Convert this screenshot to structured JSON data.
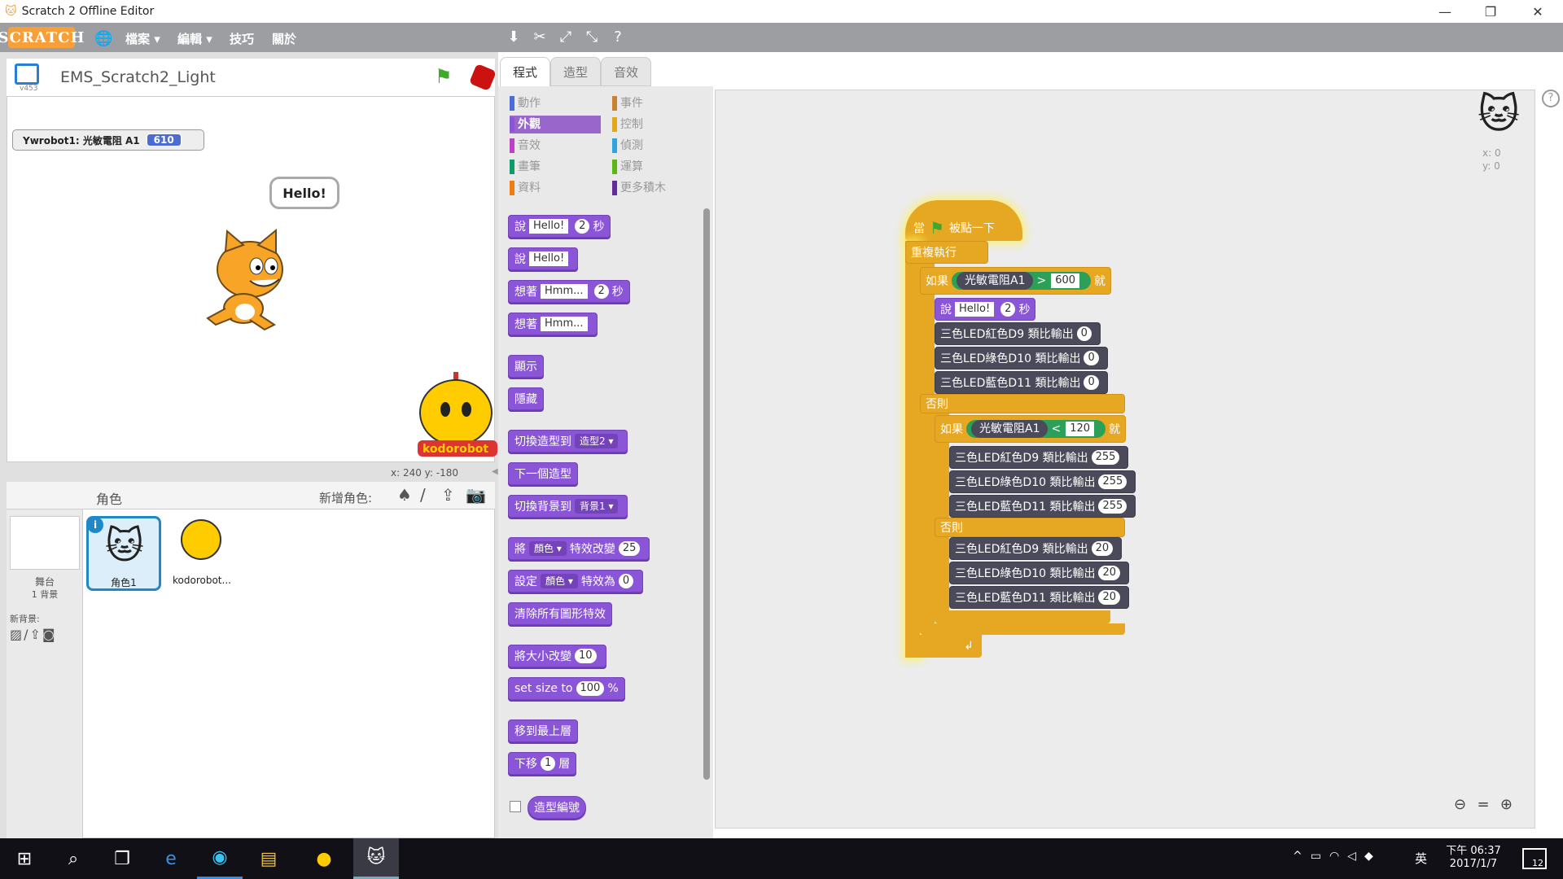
{
  "window": {
    "title": "Scratch 2 Offline Editor",
    "minimize": "—",
    "maximize": "❐",
    "close": "✕"
  },
  "menubar": {
    "logo": "SCRATCH",
    "items": [
      "檔案 ▾",
      "編輯 ▾",
      "技巧",
      "關於"
    ]
  },
  "stage": {
    "project_title": "EMS_Scratch2_Light",
    "version": "v453",
    "monitor_label": "Ywrobot1: 光敏電阻 A1",
    "monitor_value": "610",
    "bubble": "Hello!",
    "coords": "x: 240   y: -180"
  },
  "sprites": {
    "header": "角色",
    "new_sprite": "新增角色:",
    "stage_label": "舞台",
    "stage_sub": "1 背景",
    "new_backdrop": "新背景:",
    "items": [
      "角色1",
      "kodorobot..."
    ],
    "info": "i"
  },
  "tabs": [
    "程式",
    "造型",
    "音效"
  ],
  "categories": [
    {
      "label": "動作",
      "color": "#4a6cd4"
    },
    {
      "label": "事件",
      "color": "#c88330"
    },
    {
      "label": "外觀",
      "color": "#8a55d7"
    },
    {
      "label": "控制",
      "color": "#e1a91a"
    },
    {
      "label": "音效",
      "color": "#bb42c3"
    },
    {
      "label": "偵測",
      "color": "#2ca5e2"
    },
    {
      "label": "畫筆",
      "color": "#0e9a6c"
    },
    {
      "label": "運算",
      "color": "#5cb712"
    },
    {
      "label": "資料",
      "color": "#ee7d16"
    },
    {
      "label": "更多積木",
      "color": "#632d99"
    }
  ],
  "palette": {
    "say_secs": [
      "說",
      "Hello!",
      "2",
      "秒"
    ],
    "say": [
      "說",
      "Hello!"
    ],
    "think_secs": [
      "想著",
      "Hmm...",
      "2",
      "秒"
    ],
    "think": [
      "想著",
      "Hmm..."
    ],
    "show": "顯示",
    "hide": "隱藏",
    "switch_costume": [
      "切換造型到",
      "造型2 ▾"
    ],
    "next_costume": "下一個造型",
    "switch_backdrop": [
      "切換背景到",
      "背景1 ▾"
    ],
    "change_effect": [
      "將",
      "顏色 ▾",
      "特效改變",
      "25"
    ],
    "set_effect": [
      "設定",
      "顏色 ▾",
      "特效為",
      "0"
    ],
    "clear_effects": "清除所有圖形特效",
    "change_size": [
      "將大小改變",
      "10"
    ],
    "set_size": [
      "set size to",
      "100",
      "%"
    ],
    "front": "移到最上層",
    "back": [
      "下移",
      "1",
      "層"
    ],
    "costume_num": "造型編號"
  },
  "script": {
    "hat": [
      "當",
      "被點一下"
    ],
    "forever": "重複執行",
    "if1": [
      "如果",
      "光敏電阻A1",
      ">",
      "600",
      "就"
    ],
    "say": [
      "說",
      "Hello!",
      "2",
      "秒"
    ],
    "rgb_a": [
      [
        "三色LED紅色D9 類比輸出",
        "0"
      ],
      [
        "三色LED綠色D10 類比輸出",
        "0"
      ],
      [
        "三色LED藍色D11 類比輸出",
        "0"
      ]
    ],
    "else1": "否則",
    "if2": [
      "如果",
      "光敏電阻A1",
      "<",
      "120",
      "就"
    ],
    "rgb_b": [
      [
        "三色LED紅色D9 類比輸出",
        "255"
      ],
      [
        "三色LED綠色D10 類比輸出",
        "255"
      ],
      [
        "三色LED藍色D11 類比輸出",
        "255"
      ]
    ],
    "else2": "否則",
    "rgb_c": [
      [
        "三色LED紅色D9 類比輸出",
        "20"
      ],
      [
        "三色LED綠色D10 類比輸出",
        "20"
      ],
      [
        "三色LED藍色D11 類比輸出",
        "20"
      ]
    ],
    "loop_arrow": "↲"
  },
  "sprite_info": {
    "x": "x: 0",
    "y": "y: 0"
  },
  "taskbar": {
    "time": "下午 06:37",
    "date": "2017/1/7",
    "ime": "英",
    "notif": "12"
  }
}
